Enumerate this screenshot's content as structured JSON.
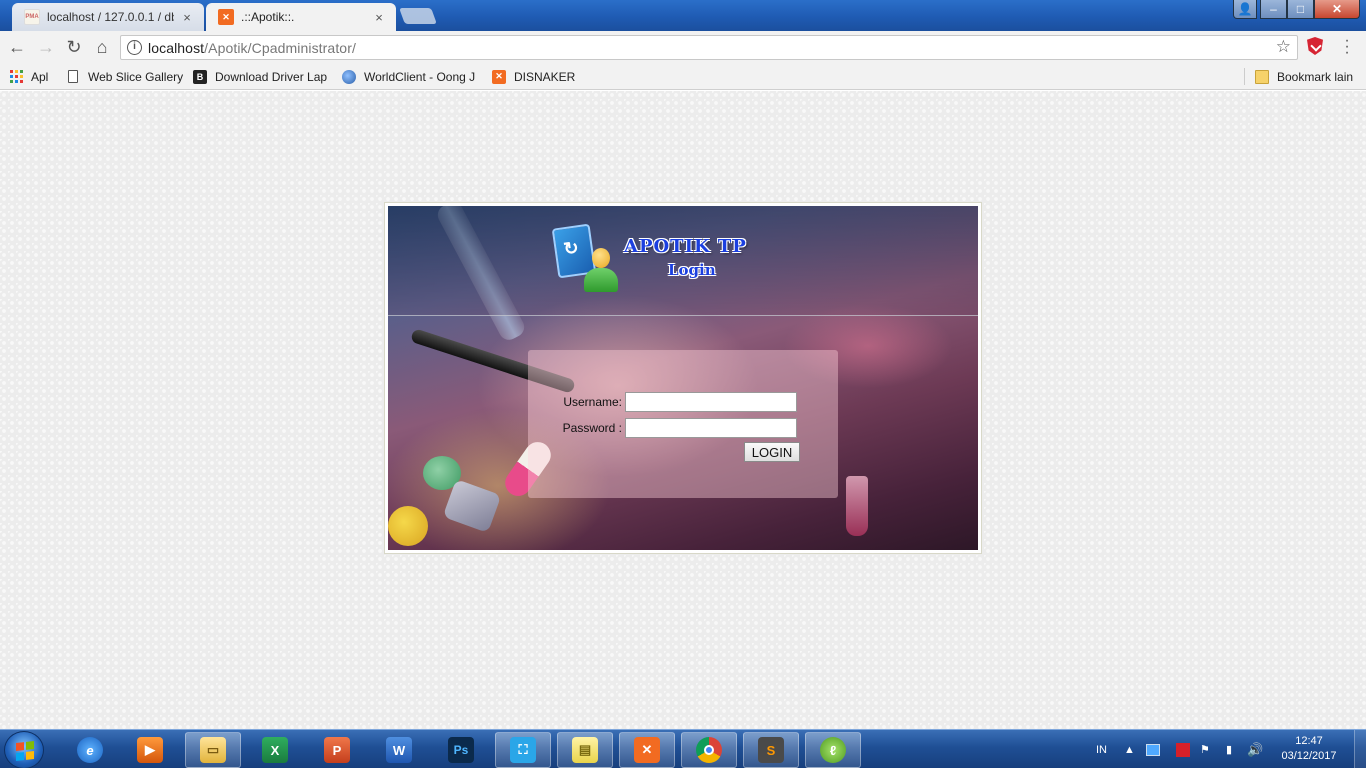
{
  "browser": {
    "tabs": [
      {
        "title": "localhost / 127.0.0.1 / db",
        "icon": "phpmyadmin-icon",
        "close": "×"
      },
      {
        "title": ".::Apotik::.",
        "icon": "xampp-icon",
        "close": "×"
      }
    ],
    "window_controls": {
      "minimize": "–",
      "maximize": "□",
      "close": "✕"
    },
    "address": {
      "host": "localhost",
      "path": "/Apotik/Cpadministrator/"
    },
    "bookmarks": [
      {
        "label": "Apl",
        "icon": "apps-grid-icon"
      },
      {
        "label": "Web Slice Gallery",
        "icon": "page-icon"
      },
      {
        "label": "Download Driver Lap",
        "icon": "blogger-icon"
      },
      {
        "label": "WorldClient - Oong J",
        "icon": "globe-icon"
      },
      {
        "label": "DISNAKER",
        "icon": "xampp-icon"
      }
    ],
    "other_bookmarks": "Bookmark lain"
  },
  "login": {
    "app_title": "APOTIK TP",
    "subtitle": "Login",
    "username_label": "Username:",
    "password_label": "Password :",
    "username_value": "",
    "password_value": "",
    "button_label": "LOGIN"
  },
  "taskbar": {
    "apps": [
      "internet-explorer-icon",
      "media-player-icon",
      "file-explorer-icon",
      "excel-icon",
      "powerpoint-icon",
      "word-icon",
      "photoshop-icon",
      "snipping-tool-icon",
      "sticky-notes-icon",
      "xampp-icon",
      "chrome-icon",
      "sublime-text-icon",
      "dreamweaver-icon"
    ],
    "language": "IN",
    "time": "12:47",
    "date": "03/12/2017"
  },
  "colors": {
    "titlebar": "#1f5bb3",
    "logo_text": "#1b3fe0",
    "xampp_orange": "#f26b21"
  }
}
